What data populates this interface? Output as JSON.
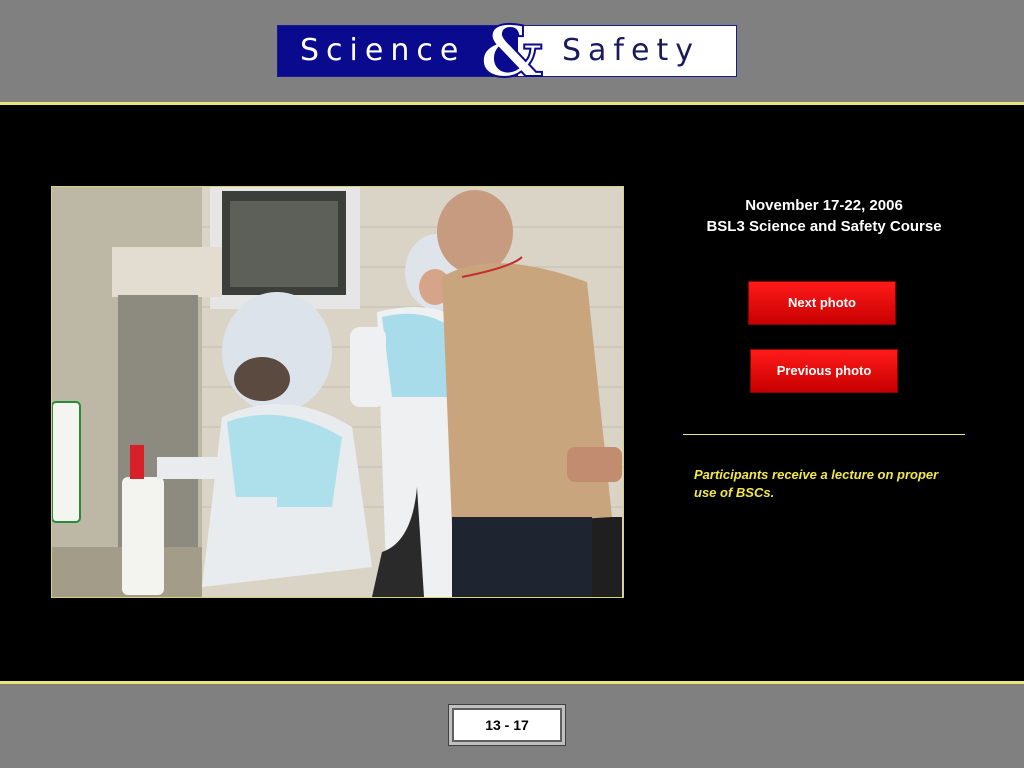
{
  "header": {
    "logo_left": "Science",
    "logo_amp": "&",
    "logo_right": "Safety"
  },
  "photo": {
    "description": "Participants receive a lecture on proper use of BSCs."
  },
  "caption": {
    "line1": "November 17-22, 2006",
    "line2": "BSL3 Science and Safety Course"
  },
  "navigation": {
    "next_label": "Next photo",
    "previous_label": "Previous photo"
  },
  "footer": {
    "counter": "13 - 17"
  },
  "colors": {
    "background": "#808080",
    "main_panel": "#000000",
    "accent_rule": "#e8e37a",
    "button_red": "#e00000",
    "description_text": "#f2e84a",
    "logo_blue": "#0a0a8e"
  }
}
